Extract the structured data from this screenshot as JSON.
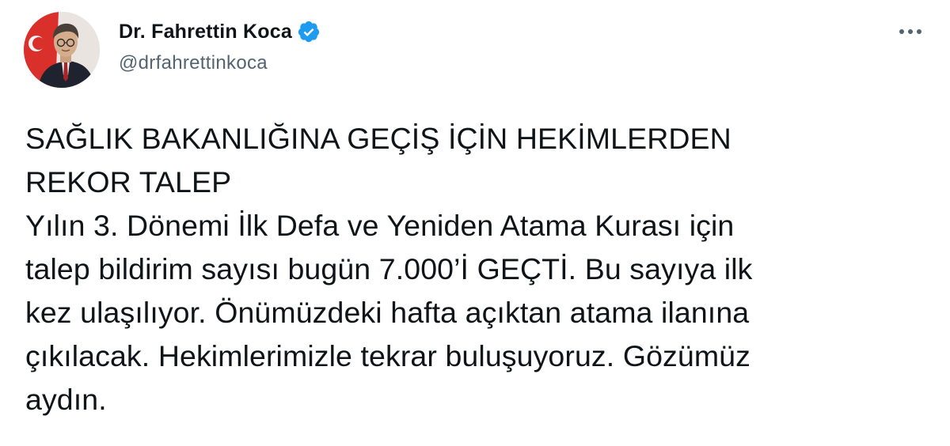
{
  "author": {
    "name": "Dr. Fahrettin Koca",
    "handle": "@drfahrettinkoca",
    "verified": true
  },
  "tweet": {
    "headline": "SAĞLIK BAKANLIĞINA GEÇİŞ İÇİN HEKİMLERDEN\nREKOR TALEP",
    "body": "Yılın 3. Dönemi İlk Defa ve Yeniden Atama Kurası için\ntalep bildirim sayısı bugün 7.000’İ GEÇTİ. Bu sayıya ilk\nkez ulaşılıyor. Önümüzdeki hafta açıktan atama ilanına\nçıkılacak. Hekimlerimizle tekrar buluşuyoruz. Gözümüz\naydın."
  },
  "icons": {
    "verified": "verified-badge-icon",
    "more": "more-options-icon"
  },
  "colors": {
    "text": "#0f1419",
    "secondary_text": "#536471",
    "verified_blue": "#1d9bf0"
  }
}
